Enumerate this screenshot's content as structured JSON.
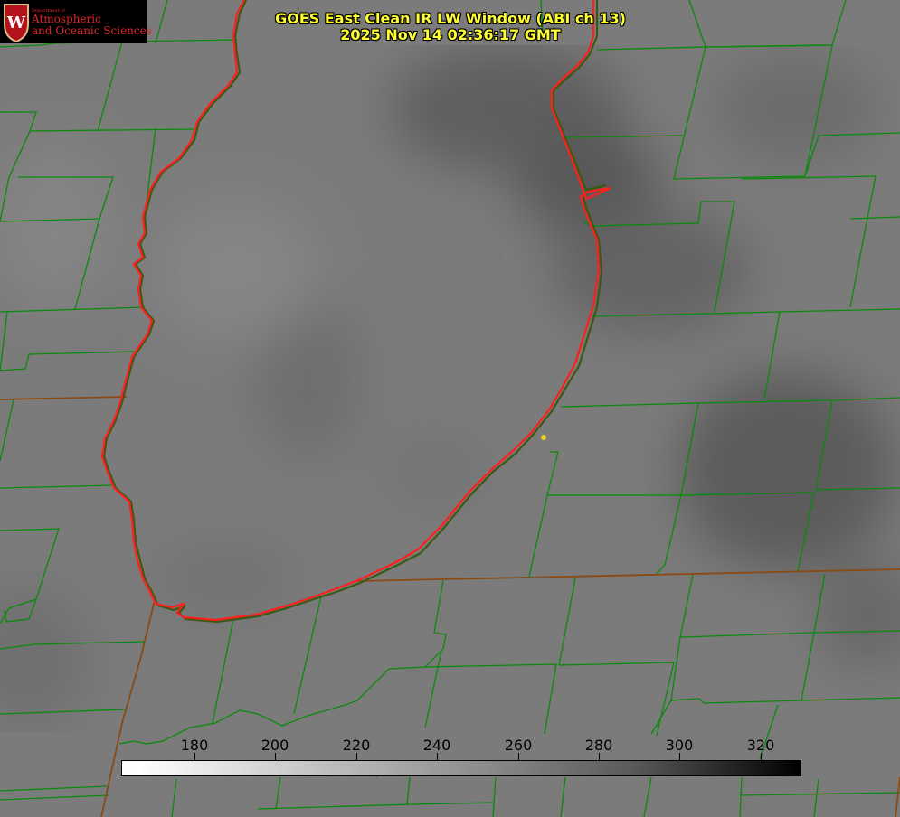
{
  "header": {
    "title_line1": "GOES East Clean IR LW Window (ABI ch 13)",
    "title_line2": "2025 Nov 14 02:36:17 GMT",
    "color": "#ffff33"
  },
  "logo": {
    "department": "Department of",
    "line1": "Atmospheric",
    "line2": "and Oceanic Sciences",
    "crest_letter": "W",
    "color": "#e0262a"
  },
  "colorbar": {
    "ticks": [
      "180",
      "200",
      "220",
      "240",
      "260",
      "280",
      "300",
      "320"
    ],
    "palette": "grayscale, white at cold end to black at warm end"
  },
  "map": {
    "boundary_color": "#008000",
    "coast_color": "#ff2020",
    "marker_color": "#e6d21a"
  }
}
